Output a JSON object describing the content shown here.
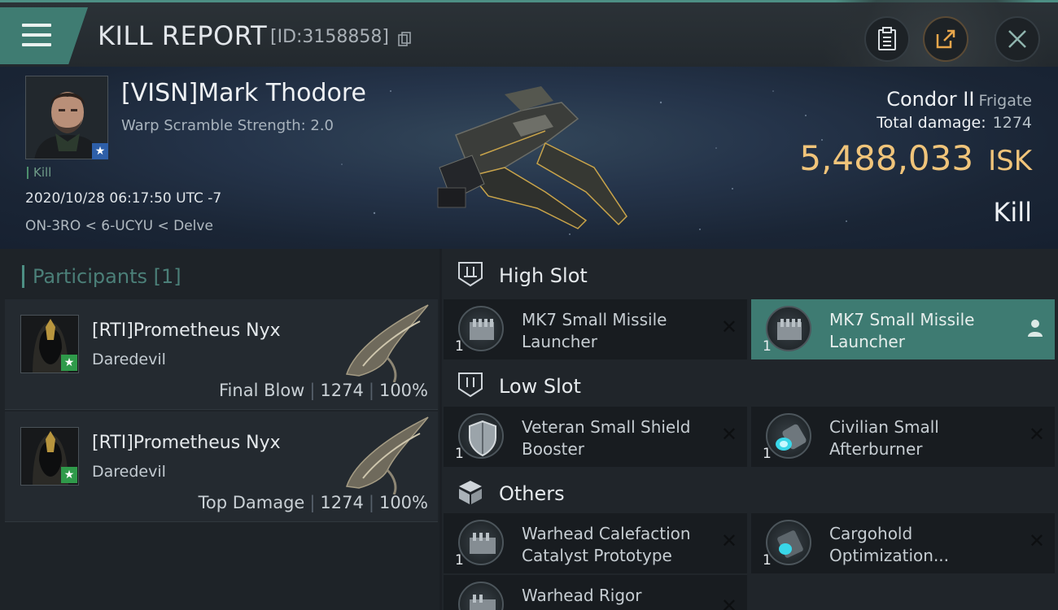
{
  "header": {
    "title": "KILL REPORT",
    "report_id": "[ID:3158858]"
  },
  "victim": {
    "name": "[VISN]Mark Thodore",
    "warp_scramble": "Warp Scramble Strength: 2.0",
    "tag": "Kill",
    "timestamp": "2020/10/28 06:17:50 UTC -7",
    "location": "ON-3RO < 6-UCYU < Delve"
  },
  "ship": {
    "name": "Condor II",
    "class": "Frigate",
    "damage_label": "Total damage:",
    "damage_value": "1274",
    "isk_value": "5,488,033",
    "isk_unit": "ISK",
    "result": "Kill"
  },
  "participants": {
    "label": "Participants",
    "count": "[1]",
    "rows": [
      {
        "name": "[RTI]Prometheus Nyx",
        "ship": "Daredevil",
        "role": "Final Blow",
        "damage": "1274",
        "percent": "100%"
      },
      {
        "name": "[RTI]Prometheus Nyx",
        "ship": "Daredevil",
        "role": "Top Damage",
        "damage": "1274",
        "percent": "100%"
      }
    ]
  },
  "fitting": {
    "high_slot_label": "High Slot",
    "low_slot_label": "Low Slot",
    "others_label": "Others",
    "high": [
      {
        "name_l1": "MK7 Small Missile",
        "name_l2": "Launcher",
        "qty": "1",
        "icon": "missile-launcher-icon"
      },
      {
        "name_l1": "MK7 Small Missile",
        "name_l2": "Launcher",
        "qty": "1",
        "icon": "missile-launcher-icon"
      }
    ],
    "low": [
      {
        "name_l1": "Veteran Small Shield",
        "name_l2": "Booster",
        "qty": "1",
        "icon": "shield-booster-icon"
      },
      {
        "name_l1": "Civilian Small",
        "name_l2": "Afterburner",
        "qty": "1",
        "icon": "afterburner-icon"
      }
    ],
    "others": [
      {
        "name_l1": "Warhead Calefaction",
        "name_l2": "Catalyst Prototype",
        "qty": "1",
        "icon": "rig-icon"
      },
      {
        "name_l1": "Cargohold",
        "name_l2": "Optimization...",
        "qty": "1",
        "icon": "rig-icon"
      },
      {
        "name_l1": "Warhead Rigor",
        "name_l2": "",
        "qty": "",
        "icon": "rig-icon"
      }
    ]
  },
  "colors": {
    "accent": "#3e7b72",
    "isk": "#f0c47a",
    "corp_badge": "#2e5fa8",
    "attacker_badge": "#2f9a4a"
  }
}
